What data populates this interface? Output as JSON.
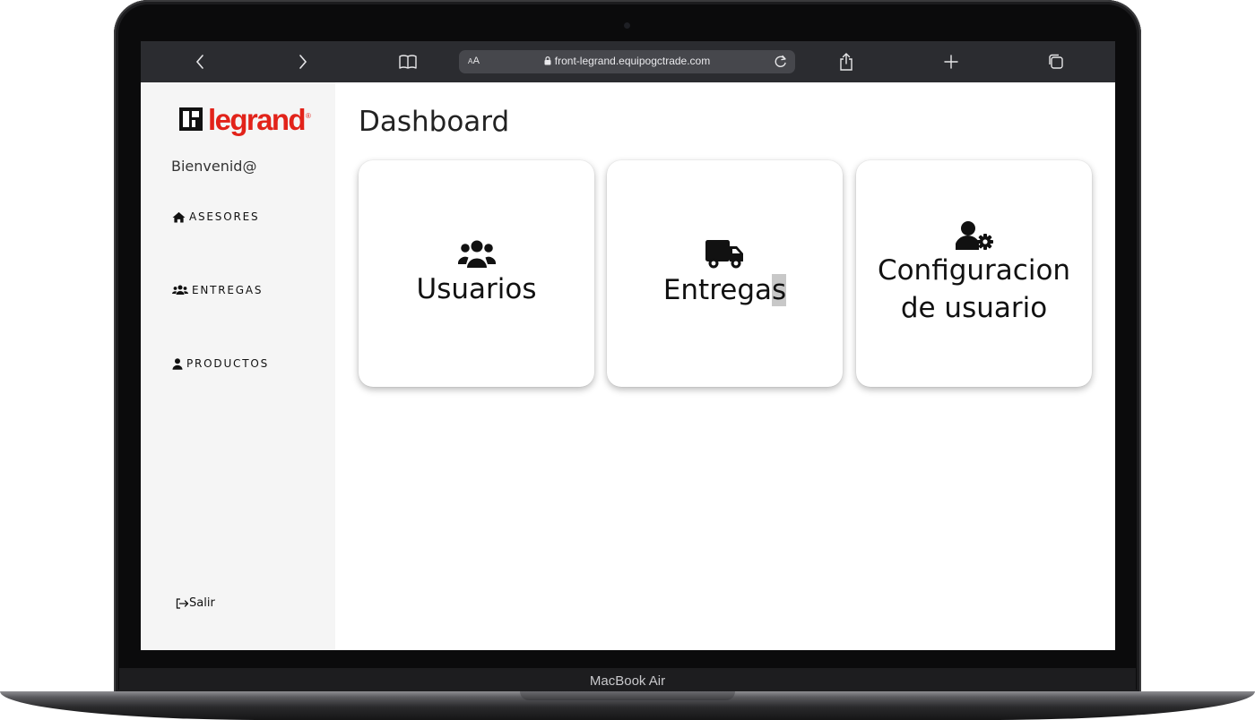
{
  "device": {
    "label": "MacBook Air"
  },
  "browser": {
    "url": "front-legrand.equipogctrade.com",
    "text_size_label": "AA"
  },
  "sidebar": {
    "logo_text": "legrand",
    "logo_reg": "®",
    "welcome": "Bienvenid@",
    "items": [
      {
        "label": "ASESORES",
        "icon": "home-icon"
      },
      {
        "label": "ENTREGAS",
        "icon": "users-icon"
      },
      {
        "label": "PRODUCTOS",
        "icon": "user-icon"
      }
    ],
    "logout": "Salir"
  },
  "main": {
    "title": "Dashboard",
    "cards": [
      {
        "label": "Usuarios",
        "icon": "users-icon"
      },
      {
        "label_main": "Entrega",
        "label_selected": "s",
        "icon": "truck-icon"
      },
      {
        "label_line1": "Configuracion",
        "label_line2": "de usuario",
        "icon": "user-gear-icon"
      }
    ]
  },
  "colors": {
    "brand": "#e2231a",
    "toolbar": "#2b2c30",
    "sidebar_bg": "#f5f5f5",
    "text_selection": "#c8c8c8"
  }
}
